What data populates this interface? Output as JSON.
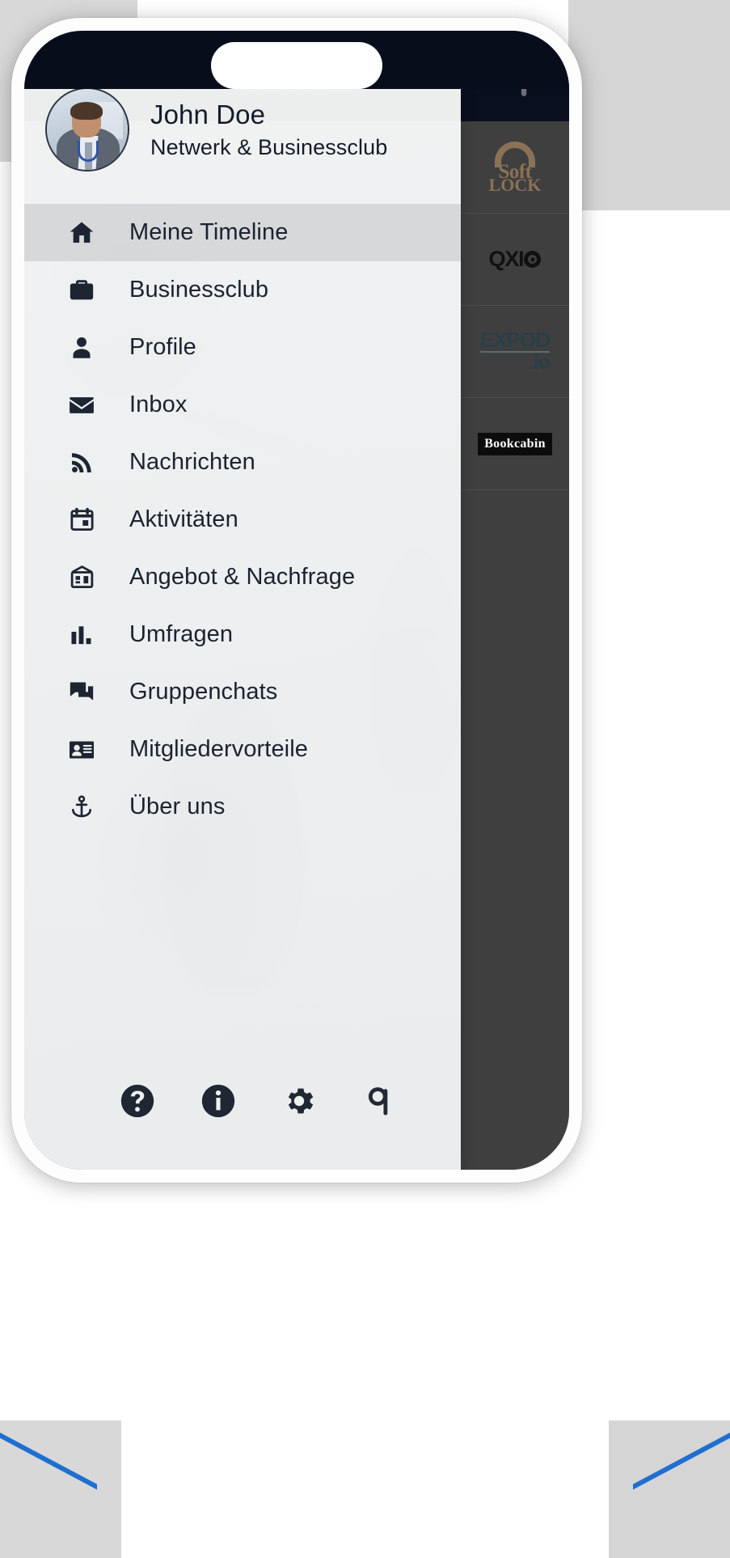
{
  "app": {
    "top_bar": {
      "back_icon": "chevron-left-icon",
      "brand_logo": "b-logo-icon"
    },
    "brand_rail": [
      {
        "name": "SoftLOCK",
        "line1": "Soft",
        "line2": "LOCK",
        "icon": "padlock-icon"
      },
      {
        "name": "QXIO",
        "text": "QXI",
        "suffix": "O"
      },
      {
        "name": "EXPOD.io",
        "line1": "EXPOD",
        "line2": ".io"
      },
      {
        "name": "Bookcabin",
        "text": "Bookcabin"
      }
    ]
  },
  "drawer": {
    "profile": {
      "avatar": "user-avatar",
      "name": "John Doe",
      "subtitle": "Netwerk & Businessclub"
    },
    "menu": [
      {
        "label": "Meine Timeline",
        "icon": "home-icon",
        "active": true
      },
      {
        "label": "Businessclub",
        "icon": "briefcase-icon",
        "active": false
      },
      {
        "label": "Profile",
        "icon": "person-icon",
        "active": false
      },
      {
        "label": "Inbox",
        "icon": "envelope-icon",
        "active": false
      },
      {
        "label": "Nachrichten",
        "icon": "rss-feed-icon",
        "active": false
      },
      {
        "label": "Aktivitäten",
        "icon": "calendar-icon",
        "active": false
      },
      {
        "label": "Angebot & Nachfrage",
        "icon": "storefront-icon",
        "active": false
      },
      {
        "label": "Umfragen",
        "icon": "bar-chart-icon",
        "active": false
      },
      {
        "label": "Gruppenchats",
        "icon": "chat-bubbles-icon",
        "active": false
      },
      {
        "label": "Mitgliedervorteile",
        "icon": "id-card-icon",
        "active": false
      },
      {
        "label": "Über uns",
        "icon": "anchor-icon",
        "active": false
      }
    ],
    "footer": [
      {
        "name": "help",
        "icon": "question-circle-icon"
      },
      {
        "name": "info",
        "icon": "info-circle-icon"
      },
      {
        "name": "settings",
        "icon": "gear-icon"
      },
      {
        "name": "brand",
        "icon": "b-logo-icon"
      }
    ]
  },
  "colors": {
    "drawer_bg": "#eef0f1",
    "active_row": "#b2b4b7",
    "icon_dark": "#1d2533",
    "status_bar": "#080d1c",
    "rail_bg": "#3f3f3f",
    "accent_blue": "#1f6fd0"
  }
}
